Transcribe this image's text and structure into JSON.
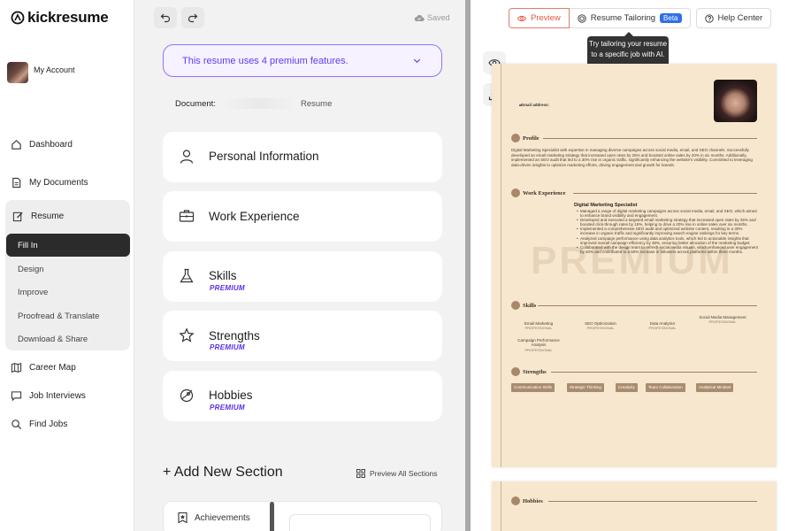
{
  "app": {
    "name": "kickresume"
  },
  "account": {
    "label": "My Account"
  },
  "nav": {
    "dashboard": "Dashboard",
    "documents": "My Documents",
    "resume": "Resume",
    "resume_sub": [
      "Fill In",
      "Design",
      "Improve",
      "Proofread & Translate",
      "Download & Share"
    ],
    "career_map": "Career Map",
    "job_interviews": "Job Interviews",
    "find_jobs": "Find Jobs"
  },
  "toolbar": {
    "saved": "Saved"
  },
  "premium_banner": "This resume uses 4 premium features.",
  "document": {
    "label": "Document:",
    "type": "Resume"
  },
  "sections": [
    {
      "title": "Personal Information",
      "icon": "person-icon",
      "badge": ""
    },
    {
      "title": "Work Experience",
      "icon": "briefcase-icon",
      "badge": ""
    },
    {
      "title": "Skills",
      "icon": "flask-icon",
      "badge": "PREMIUM"
    },
    {
      "title": "Strengths",
      "icon": "star-icon",
      "badge": "PREMIUM"
    },
    {
      "title": "Hobbies",
      "icon": "rocket-icon",
      "badge": "PREMIUM"
    }
  ],
  "add_section": "+ Add New Section",
  "preview_all": "Preview All Sections",
  "achievements": "Achievements",
  "preview_tabs": {
    "preview": "Preview",
    "tailoring": "Resume Tailoring",
    "beta": "Beta",
    "help": "Help Center"
  },
  "tooltip": "Try tailoring your resume to a specific job with AI.",
  "resume_doc": {
    "email_label": "Email address:",
    "watermark": "PREMIUM",
    "profile_head": "Profile",
    "profile_text": "Digital Marketing Specialist with expertise in managing diverse campaigns across social media, email, and SEO channels. Successfully developed an email marketing strategy that increased open rates by 25% and boosted online sales by 20% in six months. Additionally, implemented an SEO audit that led to a 30% rise in organic traffic, significantly enhancing the website's visibility. Committed to leveraging data-driven insights to optimize marketing efforts, driving engagement and growth for brands.",
    "work_head": "Work Experience",
    "job_title": "Digital Marketing Specialist",
    "bullets": [
      "Managed a range of digital marketing campaigns across social media, email, and SEO, which aimed to enhance brand visibility and engagement.",
      "Developed and executed a targeted email marketing strategy that increased open rates by 25% and boosted click-through rates by 15%, helping to drive a 20% rise in online sales over six months.",
      "Implemented a comprehensive SEO audit and optimized website content, resulting in a 30% increase in organic traffic and significantly improving search engine rankings for key terms.",
      "Analyzed campaign performance using data analytics tools, which led to actionable insights that improved overall campaign efficiency by 35%, ensuring better allocation of the marketing budget.",
      "Collaborated with the design team to refresh social media visuals, which enhanced user engagement by 40% and contributed to a 50% increase in followers across platforms within three months."
    ],
    "skills_head": "Skills",
    "skills": [
      {
        "name": "Email Marketing",
        "level": "PROFESSIONAL"
      },
      {
        "name": "SEO Optimization",
        "level": "PROFESSIONAL"
      },
      {
        "name": "Data Analytics",
        "level": "PROFESSIONAL"
      },
      {
        "name": "Social Media Management",
        "level": "PROFESSIONAL"
      },
      {
        "name": "Campaign Performance Analysis",
        "level": "PROFESSIONAL"
      }
    ],
    "strengths_head": "Strengths",
    "strengths": [
      "Communication Skills",
      "Strategic Thinking",
      "Creativity",
      "Team Collaboration",
      "Analytical Mindset"
    ],
    "hobbies_head": "Hobbies"
  }
}
